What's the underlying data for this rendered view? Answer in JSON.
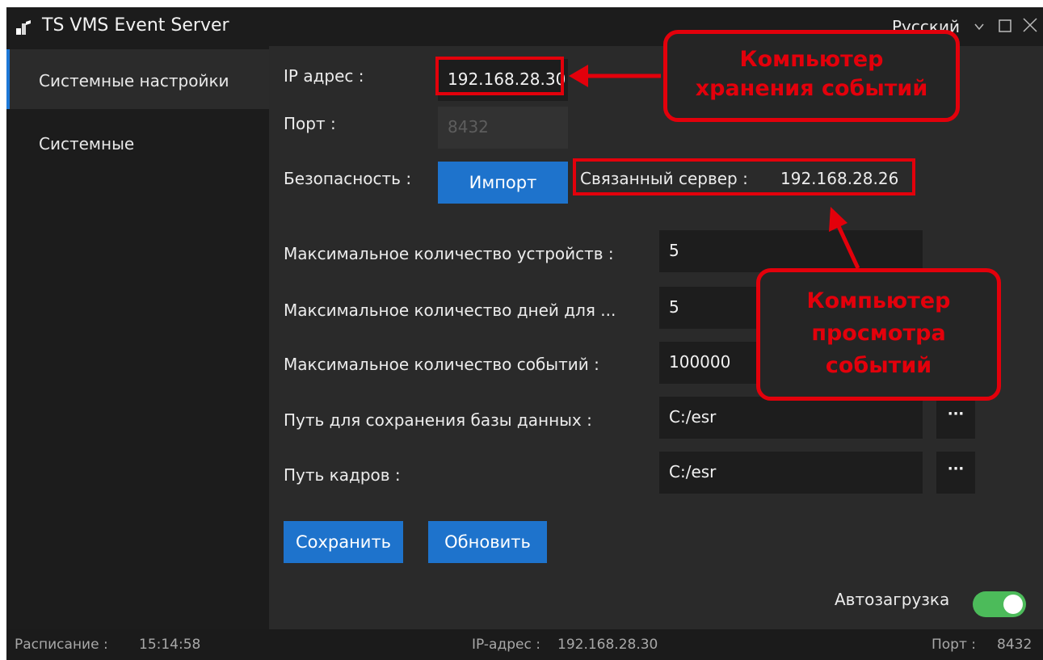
{
  "window": {
    "title": "TS VMS Event Server",
    "language": "Русский"
  },
  "sidebar": {
    "items": [
      {
        "label": "Системные настройки",
        "active": true
      },
      {
        "label": "Системные",
        "active": false
      }
    ]
  },
  "form": {
    "ip_label": "IP адрес :",
    "ip_value": "192.168.28.30",
    "port_label": "Порт :",
    "port_value": "8432",
    "security_label": "Безопасность :",
    "import_button": "Импорт",
    "linked_server_label": "Связанный сервер :",
    "linked_server_value": "192.168.28.26",
    "max_devices_label": "Максимальное количество устройств :",
    "max_devices_value": "5",
    "max_days_label": "Максимальное количество дней для ...",
    "max_days_value": "5",
    "max_events_label": "Максимальное количество событий :",
    "max_events_value": "100000",
    "db_path_label": "Путь для сохранения базы данных :",
    "db_path_value": "C:/esr",
    "frames_path_label": "Путь кадров :",
    "frames_path_value": "C:/esr",
    "browse_label": "···",
    "save_button": "Сохранить",
    "refresh_button": "Обновить",
    "autoload_label": "Автозагрузка",
    "autoload_enabled": true
  },
  "statusbar": {
    "schedule_label": "Расписание :",
    "schedule_time": "15:14:58",
    "ip_label": "IP-адрес :",
    "ip_value": "192.168.28.30",
    "port_label": "Порт :",
    "port_value": "8432"
  },
  "annotations": {
    "storage_computer": [
      "Компьютер",
      "хранения событий"
    ],
    "viewing_computer": [
      "Компьютер",
      "просмотра",
      "событий"
    ]
  },
  "colors": {
    "accent": "#1e73cc",
    "annotation": "#e3000b",
    "toggle_on": "#4cbb5a"
  }
}
